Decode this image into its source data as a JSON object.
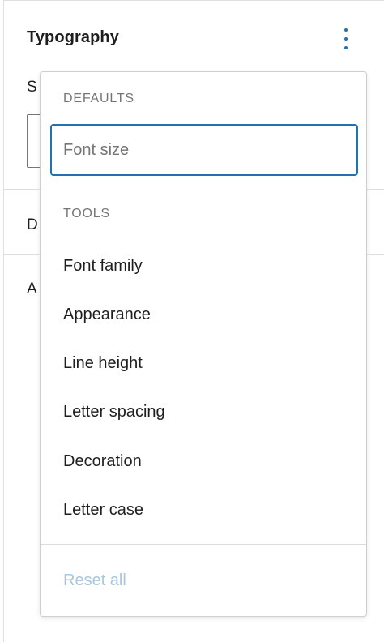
{
  "panel": {
    "title": "Typography",
    "partial_labels": [
      "S",
      "D",
      "A"
    ]
  },
  "menu": {
    "defaults_heading": "DEFAULTS",
    "defaults_items": [
      "Font size"
    ],
    "tools_heading": "TOOLS",
    "tools_items": [
      "Font family",
      "Appearance",
      "Line height",
      "Letter spacing",
      "Decoration",
      "Letter case"
    ],
    "reset_label": "Reset all"
  },
  "icons": {
    "options": "more-vertical-icon"
  },
  "colors": {
    "accent": "#2271b1",
    "muted": "#757575",
    "disabled": "#a7c7e0"
  }
}
